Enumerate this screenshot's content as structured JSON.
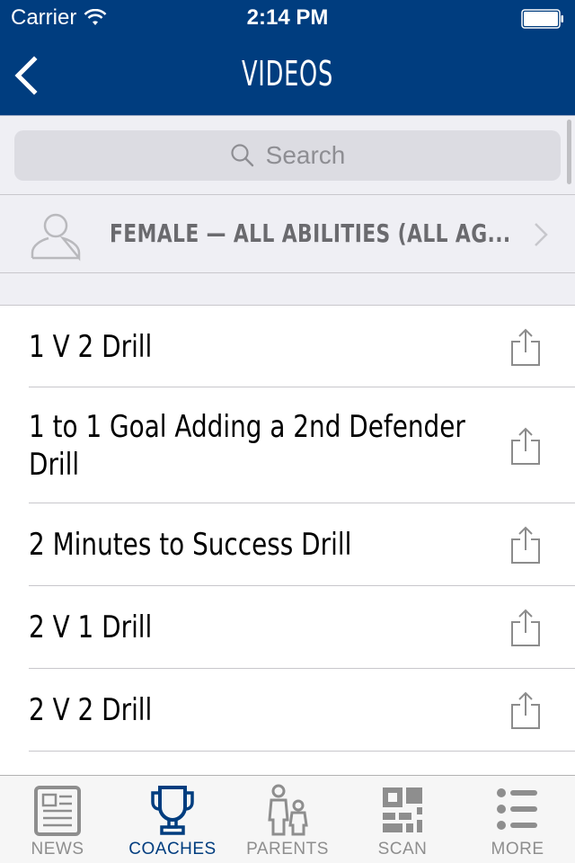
{
  "status_bar": {
    "carrier": "Carrier",
    "time": "2:14 PM"
  },
  "nav": {
    "title": "VIDEOS",
    "back_icon": "chevron-left-icon"
  },
  "search": {
    "placeholder": "Search",
    "icon": "search-icon"
  },
  "filter": {
    "text": "FEMALE  —  ALL ABILITIES (ALL AG...",
    "icon": "person-icon"
  },
  "videos": [
    {
      "title": "1 V 2 Drill"
    },
    {
      "title": "1 to 1 Goal Adding a 2nd Defender Drill"
    },
    {
      "title": "2 Minutes to Success Drill"
    },
    {
      "title": "2 V 1 Drill"
    },
    {
      "title": "2 V 2 Drill"
    }
  ],
  "tabbar": {
    "tabs": [
      {
        "label": "NEWS",
        "icon": "newspaper-icon",
        "active": false
      },
      {
        "label": "COACHES",
        "icon": "trophy-icon",
        "active": true
      },
      {
        "label": "PARENTS",
        "icon": "parent-child-icon",
        "active": false
      },
      {
        "label": "SCAN",
        "icon": "qr-code-icon",
        "active": false
      },
      {
        "label": "MORE",
        "icon": "list-icon",
        "active": false
      }
    ]
  },
  "colors": {
    "brand": "#003d7f",
    "inactive": "#8e8e8e"
  }
}
